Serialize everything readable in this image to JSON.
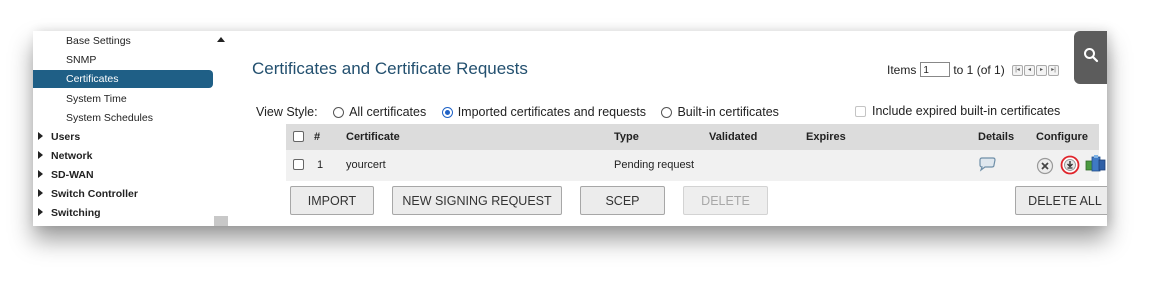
{
  "sidebar": {
    "sub_items": [
      {
        "label": "Base Settings",
        "active": false
      },
      {
        "label": "SNMP",
        "active": false
      },
      {
        "label": "Certificates",
        "active": true
      },
      {
        "label": "System Time",
        "active": false
      },
      {
        "label": "System Schedules",
        "active": false
      }
    ],
    "groups": [
      "Users",
      "Network",
      "SD-WAN",
      "Switch Controller",
      "Switching"
    ]
  },
  "main": {
    "title": "Certificates and Certificate Requests",
    "items_label": "Items",
    "items_value": "1",
    "items_range": "to 1 (of 1)",
    "view_style": {
      "label": "View Style:",
      "options": [
        "All certificates",
        "Imported certificates and requests",
        "Built-in certificates"
      ],
      "selected": "Imported certificates and requests"
    },
    "include_expired_label": "Include expired built-in certificates",
    "table": {
      "headers": {
        "num": "#",
        "certificate": "Certificate",
        "type": "Type",
        "validated": "Validated",
        "expires": "Expires",
        "details": "Details",
        "configure": "Configure"
      },
      "rows": [
        {
          "num": "1",
          "certificate": "yourcert",
          "type": "Pending request",
          "validated": "",
          "expires": ""
        }
      ]
    },
    "buttons": {
      "import": "IMPORT",
      "new_signing_request": "NEW SIGNING REQUEST",
      "scep": "SCEP",
      "delete": "DELETE",
      "delete_all": "DELETE ALL"
    }
  },
  "icons": {
    "search": "search-icon",
    "details": "speech-bubble-icon",
    "remove": "x-circle-icon",
    "download": "download-icon",
    "configure": "blocks-icon"
  },
  "colors": {
    "accent": "#1f5f86",
    "title": "#23506f",
    "highlight_ring": "#e0242b",
    "radio_selected": "#1f62c6"
  }
}
